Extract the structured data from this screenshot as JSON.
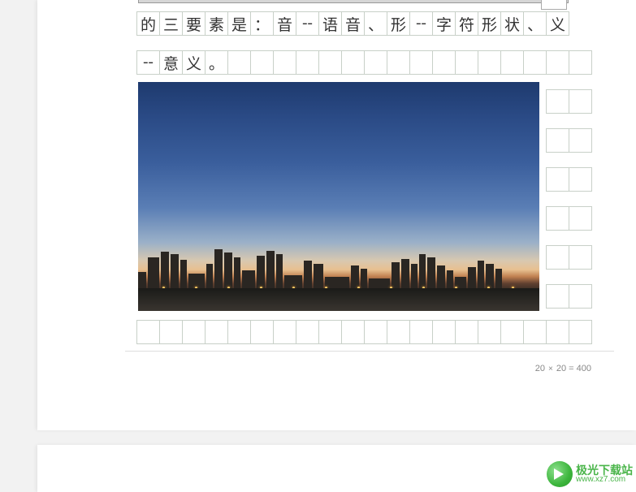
{
  "grid": {
    "cols": 20,
    "row1_chars": [
      "的",
      "三",
      "要",
      "素",
      "是",
      "：",
      "音",
      "--",
      "语",
      "音",
      "、",
      "形",
      "--",
      "字",
      "符",
      "形",
      "状",
      "、",
      "义"
    ],
    "row2_chars": [
      "--",
      "意",
      "义",
      "。"
    ]
  },
  "footer": {
    "left_num": "20",
    "multiply": "×",
    "right_expr": "20 = 400"
  },
  "watermark": {
    "cn": "极光下载站",
    "url": "www.xz7.com"
  },
  "image": {
    "alt": "cityscape-dusk"
  }
}
